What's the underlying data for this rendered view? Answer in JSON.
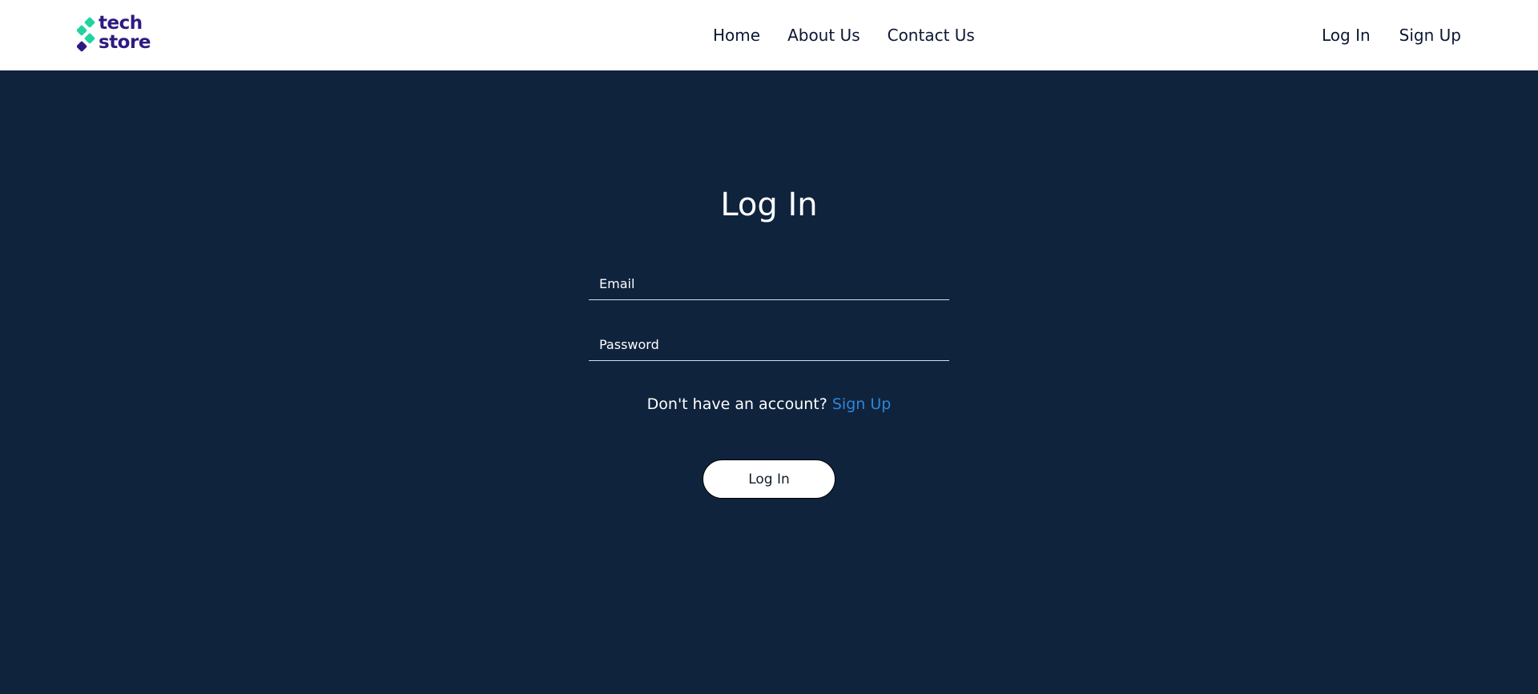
{
  "header": {
    "logo": {
      "line1": "tech",
      "line2": "store"
    },
    "nav": [
      "Home",
      "About Us",
      "Contact Us"
    ],
    "auth": {
      "login": "Log In",
      "signup": "Sign Up"
    }
  },
  "login_form": {
    "title": "Log In",
    "email_placeholder": "Email",
    "email_value": "",
    "password_placeholder": "Password",
    "password_value": "",
    "signup_prompt": "Don't have an account?",
    "signup_link": "Sign Up",
    "submit_label": "Log In"
  },
  "colors": {
    "background": "#0f233d",
    "header": "#ffffff",
    "logo_accent": "#1fd4a0",
    "logo_dark": "#2e1a80",
    "link": "#2f86d6"
  }
}
